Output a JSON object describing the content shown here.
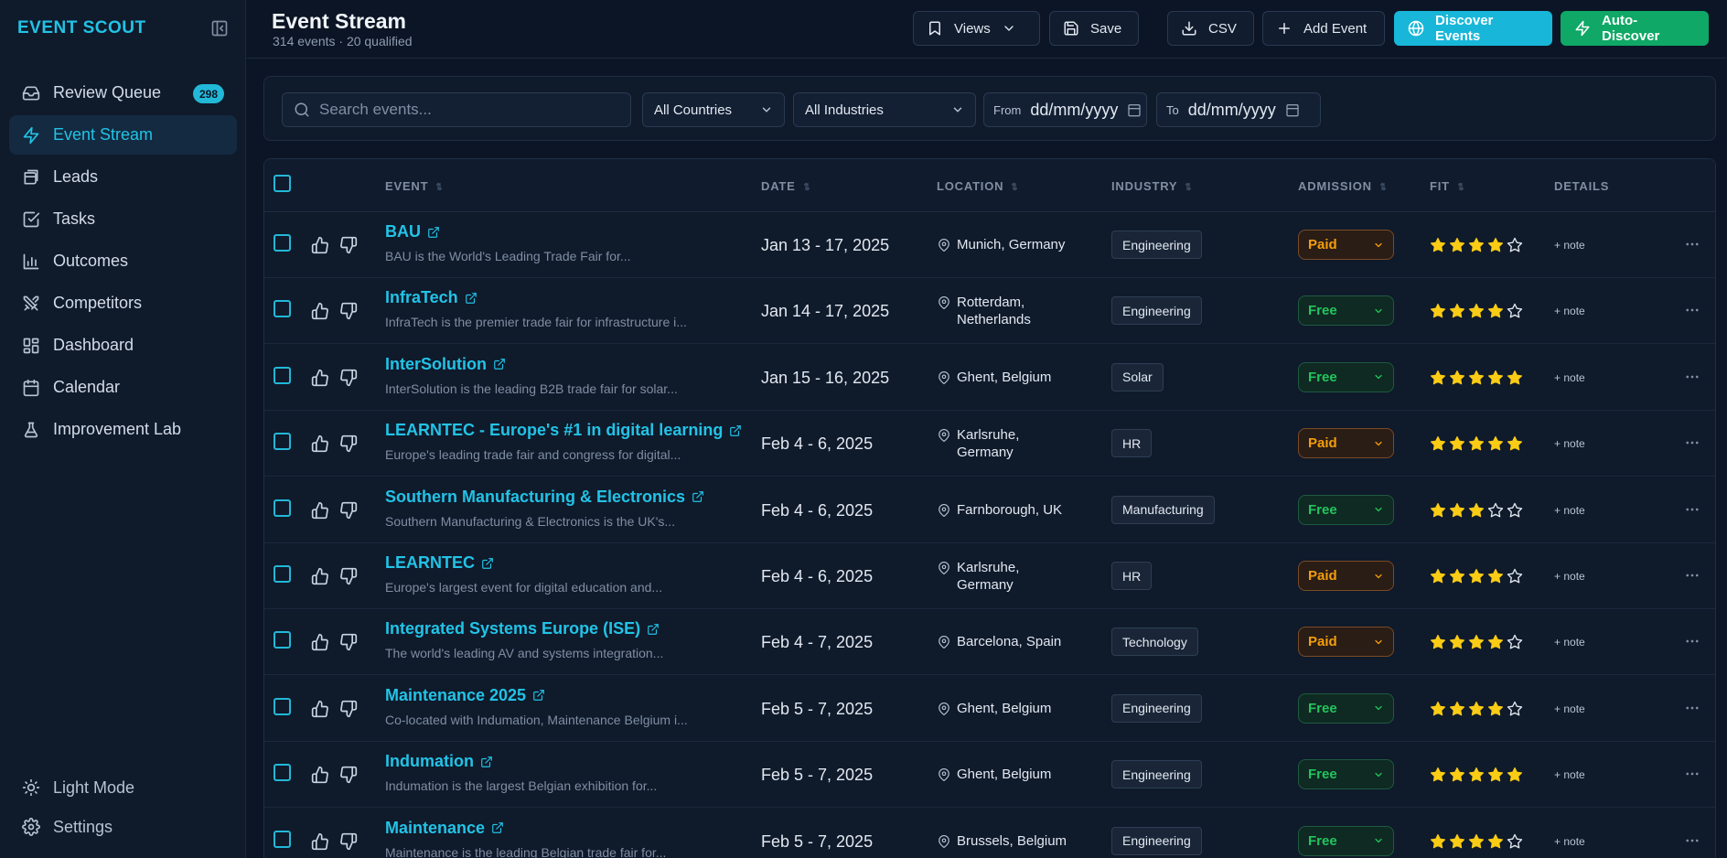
{
  "app": {
    "brand": "EVENT SCOUT"
  },
  "nav": {
    "items": [
      {
        "label": "Review Queue",
        "icon": "inbox-icon",
        "badge": "298",
        "active": false
      },
      {
        "label": "Event Stream",
        "icon": "zap-icon",
        "active": true
      },
      {
        "label": "Leads",
        "icon": "stack-icon",
        "active": false
      },
      {
        "label": "Tasks",
        "icon": "check-square-icon",
        "active": false
      },
      {
        "label": "Outcomes",
        "icon": "bar-chart-icon",
        "active": false
      },
      {
        "label": "Competitors",
        "icon": "swords-icon",
        "active": false
      },
      {
        "label": "Dashboard",
        "icon": "layout-dashboard-icon",
        "active": false
      },
      {
        "label": "Calendar",
        "icon": "calendar-icon",
        "active": false
      },
      {
        "label": "Improvement Lab",
        "icon": "flask-icon",
        "active": false
      }
    ],
    "bottom": [
      {
        "label": "Light Mode",
        "icon": "sun-icon"
      },
      {
        "label": "Settings",
        "icon": "gear-icon"
      }
    ]
  },
  "header": {
    "title": "Event Stream",
    "subtitle": "314 events · 20 qualified",
    "buttons": {
      "views": "Views",
      "save": "Save",
      "csv": "CSV",
      "add_event": "Add Event",
      "discover": "Discover Events",
      "auto_discover": "Auto-Discover"
    }
  },
  "filters": {
    "search_placeholder": "Search events...",
    "country": "All Countries",
    "industry": "All Industries",
    "from_label": "From",
    "from_value": "dd/mm/yyyy",
    "to_label": "To",
    "to_value": "dd/mm/yyyy"
  },
  "table": {
    "columns": {
      "event": "EVENT",
      "date": "DATE",
      "location": "LOCATION",
      "industry": "INDUSTRY",
      "admission": "ADMISSION",
      "fit": "FIT",
      "details": "DETAILS"
    },
    "note_label": "+ note",
    "rows": [
      {
        "name": "BAU",
        "desc": "BAU is the World's Leading Trade Fair for...",
        "date": "Jan 13 - 17, 2025",
        "loc1": "Munich, Germany",
        "loc2": "",
        "industry": "Engineering",
        "admission": "Paid",
        "fit": 4
      },
      {
        "name": "InfraTech",
        "desc": "InfraTech is the premier trade fair for infrastructure i...",
        "date": "Jan 14 - 17, 2025",
        "loc1": "Rotterdam,",
        "loc2": "Netherlands",
        "industry": "Engineering",
        "admission": "Free",
        "fit": 4
      },
      {
        "name": "InterSolution",
        "desc": "InterSolution is the leading B2B trade fair for solar...",
        "date": "Jan 15 - 16, 2025",
        "loc1": "Ghent, Belgium",
        "loc2": "",
        "industry": "Solar",
        "admission": "Free",
        "fit": 5
      },
      {
        "name": "LEARNTEC - Europe's #1 in digital learning",
        "desc": "Europe's leading trade fair and congress for digital...",
        "date": "Feb 4 - 6, 2025",
        "loc1": "Karlsruhe,",
        "loc2": "Germany",
        "industry": "HR",
        "admission": "Paid",
        "fit": 5
      },
      {
        "name": "Southern Manufacturing & Electronics",
        "desc": "Southern Manufacturing & Electronics is the UK's...",
        "date": "Feb 4 - 6, 2025",
        "loc1": "Farnborough, UK",
        "loc2": "",
        "industry": "Manufacturing",
        "admission": "Free",
        "fit": 3
      },
      {
        "name": "LEARNTEC",
        "desc": "Europe's largest event for digital education and...",
        "date": "Feb 4 - 6, 2025",
        "loc1": "Karlsruhe,",
        "loc2": "Germany",
        "industry": "HR",
        "admission": "Paid",
        "fit": 4
      },
      {
        "name": "Integrated Systems Europe (ISE)",
        "desc": "The world's leading AV and systems integration...",
        "date": "Feb 4 - 7, 2025",
        "loc1": "Barcelona, Spain",
        "loc2": "",
        "industry": "Technology",
        "admission": "Paid",
        "fit": 4
      },
      {
        "name": "Maintenance 2025",
        "desc": "Co-located with Indumation, Maintenance Belgium i...",
        "date": "Feb 5 - 7, 2025",
        "loc1": "Ghent, Belgium",
        "loc2": "",
        "industry": "Engineering",
        "admission": "Free",
        "fit": 4
      },
      {
        "name": "Indumation",
        "desc": "Indumation is the largest Belgian exhibition for...",
        "date": "Feb 5 - 7, 2025",
        "loc1": "Ghent, Belgium",
        "loc2": "",
        "industry": "Engineering",
        "admission": "Free",
        "fit": 5
      },
      {
        "name": "Maintenance",
        "desc": "Maintenance is the leading Belgian trade fair for...",
        "date": "Feb 5 - 7, 2025",
        "loc1": "Brussels, Belgium",
        "loc2": "",
        "industry": "Engineering",
        "admission": "Free",
        "fit": 4
      }
    ]
  },
  "colors": {
    "accent": "#22c3e6",
    "paid": "#f59e0b",
    "free": "#22c55e",
    "star": "#facc15",
    "auto_discover": "#0fa866"
  }
}
